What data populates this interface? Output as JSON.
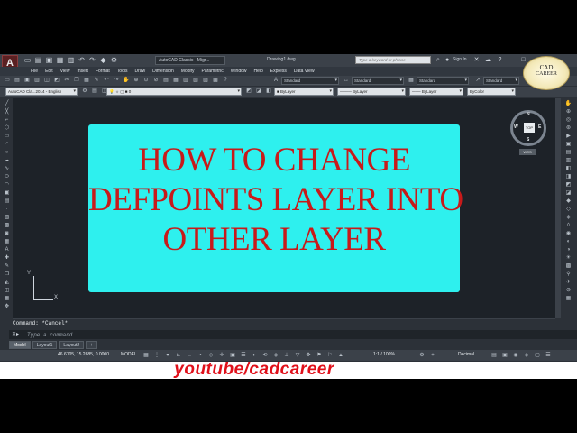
{
  "titlebar": {
    "app_logo": "A",
    "workspace": "AutoCAD Classic - Migr...",
    "document_title": "Drawing1.dwg",
    "search_placeholder": "Type a keyword or phrase",
    "sign_in": "Sign In"
  },
  "menu": {
    "items": [
      "File",
      "Edit",
      "View",
      "Insert",
      "Format",
      "Tools",
      "Draw",
      "Dimension",
      "Modify",
      "Parametric",
      "Window",
      "Help",
      "Express",
      "Data View"
    ]
  },
  "toolbar1": {
    "text_style": "Standard",
    "dim_style": "Standard",
    "table_style": "Standard",
    "multileader_style": "Standard"
  },
  "toolbar2": {
    "workspace": "AutoCAD Cla...2014 - English",
    "layer": "0",
    "color": "ByLayer",
    "linetype": "ByLayer",
    "lineweight": "ByLayer",
    "plot_style": "ByColor"
  },
  "logo": {
    "line1": "CAD",
    "line2": "CAREER"
  },
  "viewcube": {
    "top": "TOP",
    "n": "N",
    "s": "S",
    "w": "W",
    "e": "E",
    "wcs": "WCS"
  },
  "ucs": {
    "y": "Y",
    "x": "X"
  },
  "banner": {
    "line1": "HOW TO CHANGE",
    "line2": "DEFPOINTS  LAYER INTO",
    "line3": "OTHER LAYER"
  },
  "command": {
    "history": "Command: *Cancel*",
    "placeholder": "Type a command"
  },
  "layout_tabs": [
    "Model",
    "Layout1",
    "Layout2",
    "+"
  ],
  "status": {
    "coords": "46.6105, 15.2685, 0.0000",
    "model": "MODEL",
    "scale": "1:1 / 100%",
    "units": "Decimal"
  },
  "watermark": "youtube/cadcareer"
}
